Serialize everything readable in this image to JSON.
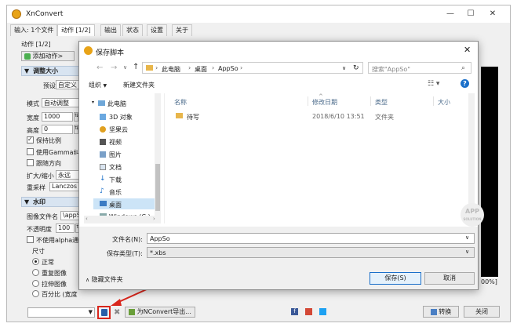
{
  "app": {
    "title": "XnConvert",
    "tabs": [
      "输入: 1个文件",
      "动作 [1/2]",
      "输出",
      "状态",
      "设置",
      "关于"
    ],
    "active_tab": 1
  },
  "actions": {
    "header": "动作 [1/2]",
    "add_action": "添加动作>",
    "resize": {
      "title": "调整大小",
      "preset_label": "预设",
      "preset_value": "自定义",
      "mode_label": "模式",
      "mode_value": "自动调整",
      "width_label": "宽度",
      "width_value": "1000",
      "height_label": "高度",
      "height_value": "0",
      "keep_ratio": "保持比例",
      "use_gamma": "使用Gamma纠正",
      "follow_dir": "跟随方向",
      "enlarge_label": "扩大/缩小",
      "enlarge_value": "永远",
      "resample_label": "重采样",
      "resample_value": "Lanczos"
    },
    "watermark": {
      "title": "水印",
      "image_label": "图像文件名",
      "image_value": "\\appSo\\",
      "opacity_label": "不透明度",
      "opacity_value": "100",
      "no_alpha": "不使用alpha通道",
      "size_label": "尺寸",
      "opt_normal": "正常",
      "opt_repeat": "重复图像",
      "opt_stretch": "拉伸图像",
      "opt_percent": "百分比 (宽度"
    }
  },
  "right_edge_text": "00%]",
  "bottom": {
    "export_btn": "为NConvert导出...",
    "convert_btn": "转换",
    "close_btn": "关闭"
  },
  "dialog": {
    "title": "保存脚本",
    "path": [
      "此电脑",
      "桌面",
      "AppSo"
    ],
    "search_placeholder": "搜索\"AppSo\"",
    "organize": "组织",
    "new_folder": "新建文件夹",
    "nav": [
      "此电脑",
      "3D 对象",
      "坚果云",
      "视频",
      "图片",
      "文档",
      "下载",
      "音乐",
      "桌面",
      "Windows (C:)"
    ],
    "selected_nav": 8,
    "columns": {
      "name": "名称",
      "date": "修改日期",
      "type": "类型",
      "size": "大小"
    },
    "files": [
      {
        "name": "待写",
        "date": "2018/6/10 13:51",
        "type": "文件夹"
      }
    ],
    "filename_label": "文件名(N):",
    "filename_value": "AppSo",
    "filetype_label": "保存类型(T):",
    "filetype_value": "*.xbs",
    "hide_folders": "隐藏文件夹",
    "save_btn": "保存(S)",
    "cancel_btn": "取消"
  },
  "watermark_logo": {
    "line1": "APP",
    "line2": "SOLUTION"
  },
  "colors": {
    "accent": "#1a6fc9",
    "arrow": "#d9261c",
    "folder": "#e8b64b",
    "highlight": "#cce4f7"
  }
}
